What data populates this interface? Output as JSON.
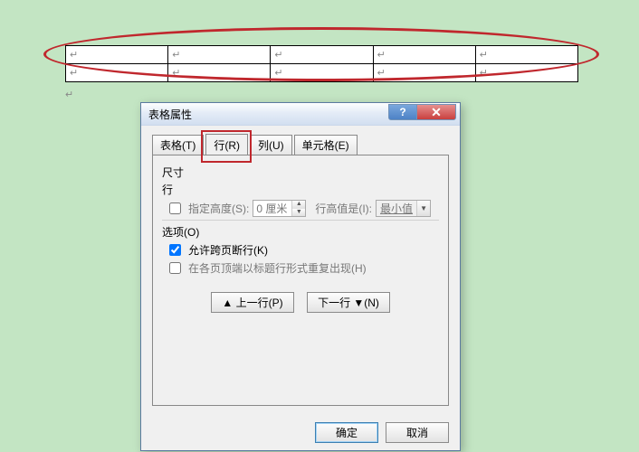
{
  "table": {
    "rows": 2,
    "cols": 5,
    "cell_mark": "↵"
  },
  "para_mark": "↵",
  "dialog": {
    "title": "表格属性",
    "help_btn": "?",
    "close_btn": "✕",
    "tabs": {
      "table": "表格(T)",
      "row": "行(R)",
      "column": "列(U)",
      "cell": "单元格(E)"
    },
    "active_tab": "row",
    "size_label": "尺寸",
    "row_label": "行",
    "specify_height_label": "指定高度(S):",
    "height_value": "0 厘米",
    "row_height_is_label": "行高值是(I):",
    "row_height_rule": "最小值",
    "options_label": "选项(O)",
    "allow_break_label": "允许跨页断行(K)",
    "allow_break_checked": true,
    "repeat_header_label": "在各页顶端以标题行形式重复出现(H)",
    "repeat_header_checked": false,
    "prev_row_btn": "▲ 上一行(P)",
    "next_row_btn": "下一行 ▼(N)",
    "ok_btn": "确定",
    "cancel_btn": "取消"
  }
}
